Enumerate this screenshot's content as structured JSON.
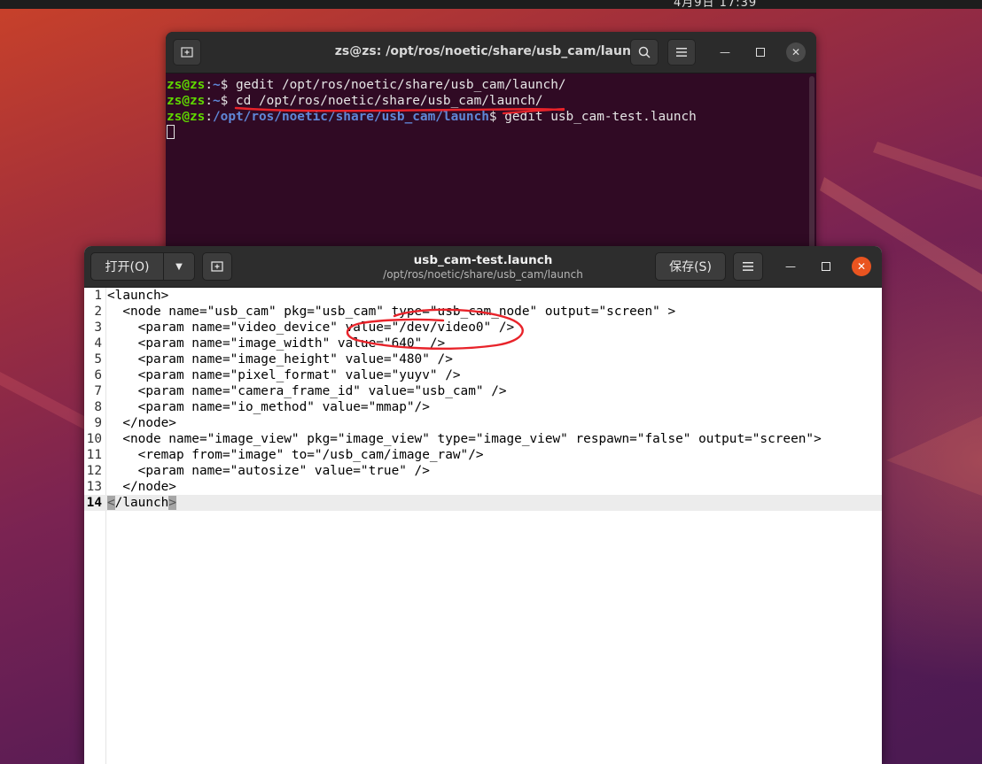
{
  "desktop": {
    "clock": "4月9日  17:39"
  },
  "terminal": {
    "title": "zs@zs: /opt/ros/noetic/share/usb_cam/launch",
    "lines": [
      {
        "user": "zs@zs",
        "sep": ":",
        "path": "~",
        "prompt": "$ ",
        "cmd": "gedit /opt/ros/noetic/share/usb_cam/launch/"
      },
      {
        "user": "zs@zs",
        "sep": ":",
        "path": "~",
        "prompt": "$ ",
        "cmd": "cd /opt/ros/noetic/share/usb_cam/launch/"
      },
      {
        "user": "zs@zs",
        "sep": ":",
        "path": "/opt/ros/noetic/share/usb_cam/launch",
        "prompt": "$ ",
        "cmd": "gedit usb_cam-test.launch"
      }
    ],
    "buttons": {
      "new_tab": "new-tab-icon",
      "search": "search-icon",
      "menu": "hamburger-menu-icon"
    },
    "colors": {
      "background": "#300a24",
      "user": "#5fd700",
      "path": "#5f87d7"
    }
  },
  "gedit": {
    "open_label": "打开(O)",
    "save_label": "保存(S)",
    "title": "usb_cam-test.launch",
    "subtitle": "/opt/ros/noetic/share/usb_cam/launch",
    "current_line": 14,
    "lines": [
      {
        "num": "1",
        "text": "<launch>"
      },
      {
        "num": "2",
        "text": "  <node name=\"usb_cam\" pkg=\"usb_cam\" type=\"usb_cam_node\" output=\"screen\" >"
      },
      {
        "num": "3",
        "text": "    <param name=\"video_device\" value=\"/dev/video0\" />"
      },
      {
        "num": "4",
        "text": "    <param name=\"image_width\" value=\"640\" />"
      },
      {
        "num": "5",
        "text": "    <param name=\"image_height\" value=\"480\" />"
      },
      {
        "num": "6",
        "text": "    <param name=\"pixel_format\" value=\"yuyv\" />"
      },
      {
        "num": "7",
        "text": "    <param name=\"camera_frame_id\" value=\"usb_cam\" />"
      },
      {
        "num": "8",
        "text": "    <param name=\"io_method\" value=\"mmap\"/>"
      },
      {
        "num": "9",
        "text": "  </node>"
      },
      {
        "num": "10",
        "text": "  <node name=\"image_view\" pkg=\"image_view\" type=\"image_view\" respawn=\"false\" output=\"screen\">"
      },
      {
        "num": "11",
        "text": "    <remap from=\"image\" to=\"/usb_cam/image_raw\"/>"
      },
      {
        "num": "12",
        "text": "    <param name=\"autosize\" value=\"true\" />"
      },
      {
        "num": "13",
        "text": "  </node>"
      }
    ],
    "last_line": {
      "num": "14",
      "open_bracket": "<",
      "text": "/launch",
      "close_bracket": ">"
    },
    "colors": {
      "accent_close": "#e95420",
      "current_line_bg": "#ececec"
    }
  },
  "annotation_color": "#e8232a"
}
